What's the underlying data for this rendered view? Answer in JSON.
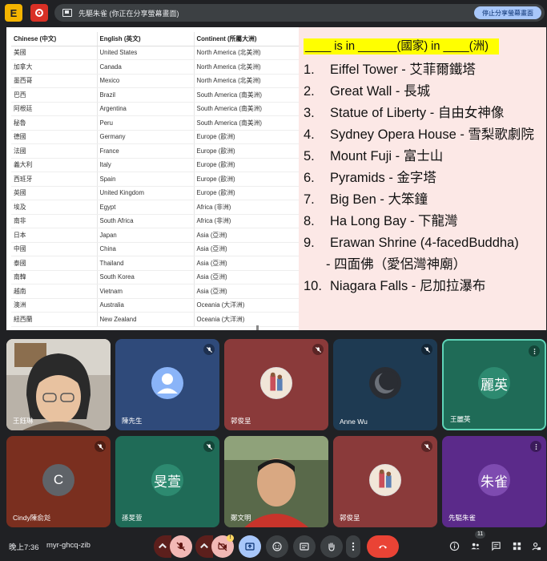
{
  "topbar": {
    "app_badge": "E",
    "share_text": "先驅朱雀 (你正在分享螢幕畫面)",
    "stop_share_label": "停止分享螢幕畫面"
  },
  "table": {
    "headers": [
      "Chinese (中文)",
      "English (英文)",
      "Continent (所屬大洲)"
    ],
    "rows": [
      [
        "美國",
        "United States",
        "North America (北美洲)"
      ],
      [
        "加拿大",
        "Canada",
        "North America (北美洲)"
      ],
      [
        "墨西哥",
        "Mexico",
        "North America (北美洲)"
      ],
      [
        "巴西",
        "Brazil",
        "South America (南美洲)"
      ],
      [
        "阿根廷",
        "Argentina",
        "South America (南美洲)"
      ],
      [
        "秘魯",
        "Peru",
        "South America (南美洲)"
      ],
      [
        "德國",
        "Germany",
        "Europe (歐洲)"
      ],
      [
        "法國",
        "France",
        "Europe (歐洲)"
      ],
      [
        "義大利",
        "Italy",
        "Europe (歐洲)"
      ],
      [
        "西班牙",
        "Spain",
        "Europe (歐洲)"
      ],
      [
        "英國",
        "United Kingdom",
        "Europe (歐洲)"
      ],
      [
        "埃及",
        "Egypt",
        "Africa (非洲)"
      ],
      [
        "南非",
        "South Africa",
        "Africa (非洲)"
      ],
      [
        "日本",
        "Japan",
        "Asia (亞洲)"
      ],
      [
        "中國",
        "China",
        "Asia (亞洲)"
      ],
      [
        "泰國",
        "Thailand",
        "Asia (亞洲)"
      ],
      [
        "南韓",
        "South Korea",
        "Asia (亞洲)"
      ],
      [
        "越南",
        "Vietnam",
        "Asia (亞洲)"
      ],
      [
        "澳洲",
        "Australia",
        "Oceania (大洋洲)"
      ],
      [
        "紐西蘭",
        "New Zealand",
        "Oceania (大洋洲)"
      ]
    ]
  },
  "quiz": {
    "title": "____ is in ______(國家) in ____(洲)",
    "items": [
      {
        "num": "1.",
        "text": "Eiffel Tower - 艾菲爾鐵塔"
      },
      {
        "num": "2.",
        "text": "Great Wall - 長城"
      },
      {
        "num": "3.",
        "text": "Statue of Liberty - 自由女神像"
      },
      {
        "num": "4.",
        "text": "Sydney Opera House - 雪梨歌劇院"
      },
      {
        "num": "5.",
        "text": "Mount Fuji - 富士山"
      },
      {
        "num": "6.",
        "text": "Pyramids - 金字塔"
      },
      {
        "num": "7.",
        "text": "Big Ben - 大笨鐘"
      },
      {
        "num": "8.",
        "text": "Ha Long Bay - 下龍灣"
      },
      {
        "num": "9.",
        "text": "Erawan Shrine (4-facedBuddha)"
      },
      {
        "num": "",
        "text": "- 四面佛（愛侶灣神廟）"
      },
      {
        "num": "10.",
        "text": "Niagara Falls - 尼加拉瀑布"
      }
    ]
  },
  "participants": [
    {
      "name": "王鈺琳",
      "avatar": "",
      "bg": "#c9c4bd",
      "muted": false,
      "kind": "camera-woman"
    },
    {
      "name": "陳先生",
      "avatar": "person-icon",
      "bg": "#2f4a7a",
      "muted": true,
      "kind": "default-avatar"
    },
    {
      "name": "郭俊呈",
      "avatar": "photo",
      "bg": "#8a3a3a",
      "muted": true,
      "kind": "photo"
    },
    {
      "name": "Anne Wu",
      "avatar": "moon-photo",
      "bg": "#1e3a52",
      "muted": true,
      "kind": "moon"
    },
    {
      "name": "王麗英",
      "avatar": "麗英",
      "bg": "#1f6b57",
      "muted": false,
      "kind": "initials"
    },
    {
      "name": "Cindy陳俞彣",
      "avatar": "C",
      "bg": "#7a2f1f",
      "muted": true,
      "kind": "letter"
    },
    {
      "name": "孫旻萱",
      "avatar": "旻萱",
      "bg": "#1f6b57",
      "muted": true,
      "kind": "initials"
    },
    {
      "name": "鄭文明",
      "avatar": "",
      "bg": "#4a5a3a",
      "muted": false,
      "kind": "camera-man"
    },
    {
      "name": "郭俊呈",
      "avatar": "photo",
      "bg": "#8a3a3a",
      "muted": true,
      "kind": "photo"
    },
    {
      "name": "先驅朱雀",
      "avatar": "朱雀",
      "bg": "#5b2a8a",
      "muted": false,
      "kind": "initials"
    }
  ],
  "bottombar": {
    "clock": "晚上7:36",
    "meeting_code": "myr-ghcq-zib",
    "people_count": "11",
    "notification_count": "!"
  },
  "colors": {
    "accent_blue": "#a8c7fa",
    "hangup_red": "#ea4335",
    "quiz_bg": "#fce8e6",
    "highlight_yellow": "#ffff00"
  }
}
